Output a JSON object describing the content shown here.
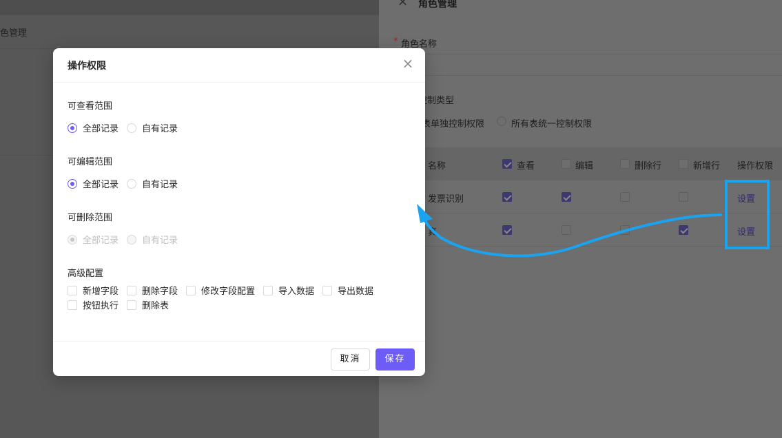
{
  "background_page": {
    "title": "色管理"
  },
  "drawer": {
    "close_icon": "close-icon",
    "title": "角色管理",
    "name_required_mark": "*",
    "name_label": "角色名称",
    "control_type_label": "控制类型",
    "control_options": [
      {
        "label": "表单独控制权限",
        "selected": true
      },
      {
        "label": "所有表统一控制权限",
        "selected": false
      }
    ],
    "table": {
      "headers": {
        "name": "名称",
        "view": "查看",
        "edit": "编辑",
        "delete_row": "删除行",
        "add_row": "新增行",
        "operation": "操作权限"
      },
      "header_view_checked": true,
      "rows": [
        {
          "name": "发票识别",
          "view": true,
          "edit": true,
          "delete_row": false,
          "add_row": false,
          "action": "设置"
        },
        {
          "name": "真",
          "view": true,
          "edit": false,
          "delete_row": false,
          "add_row": true,
          "action": "设置"
        }
      ]
    }
  },
  "modal": {
    "title": "操作权限",
    "close_icon": "close-icon",
    "sections": {
      "view_scope": {
        "label": "可查看范围",
        "options": [
          {
            "label": "全部记录",
            "checked": true,
            "disabled": false
          },
          {
            "label": "自有记录",
            "checked": false,
            "disabled": false
          }
        ]
      },
      "edit_scope": {
        "label": "可编辑范围",
        "options": [
          {
            "label": "全部记录",
            "checked": true,
            "disabled": false
          },
          {
            "label": "自有记录",
            "checked": false,
            "disabled": false
          }
        ]
      },
      "delete_scope": {
        "label": "可删除范围",
        "options": [
          {
            "label": "全部记录",
            "checked": true,
            "disabled": true
          },
          {
            "label": "自有记录",
            "checked": false,
            "disabled": true
          }
        ]
      },
      "advanced": {
        "label": "高级配置",
        "options": [
          {
            "label": "新增字段",
            "checked": false
          },
          {
            "label": "删除字段",
            "checked": false
          },
          {
            "label": "修改字段配置",
            "checked": false
          },
          {
            "label": "导入数据",
            "checked": false
          },
          {
            "label": "导出数据",
            "checked": false
          },
          {
            "label": "按钮执行",
            "checked": false
          },
          {
            "label": "删除表",
            "checked": false
          }
        ]
      }
    },
    "buttons": {
      "cancel": "取消",
      "save": "保存"
    }
  },
  "colors": {
    "accent": "#6e5cf6",
    "annotation": "#1aa3ee"
  }
}
